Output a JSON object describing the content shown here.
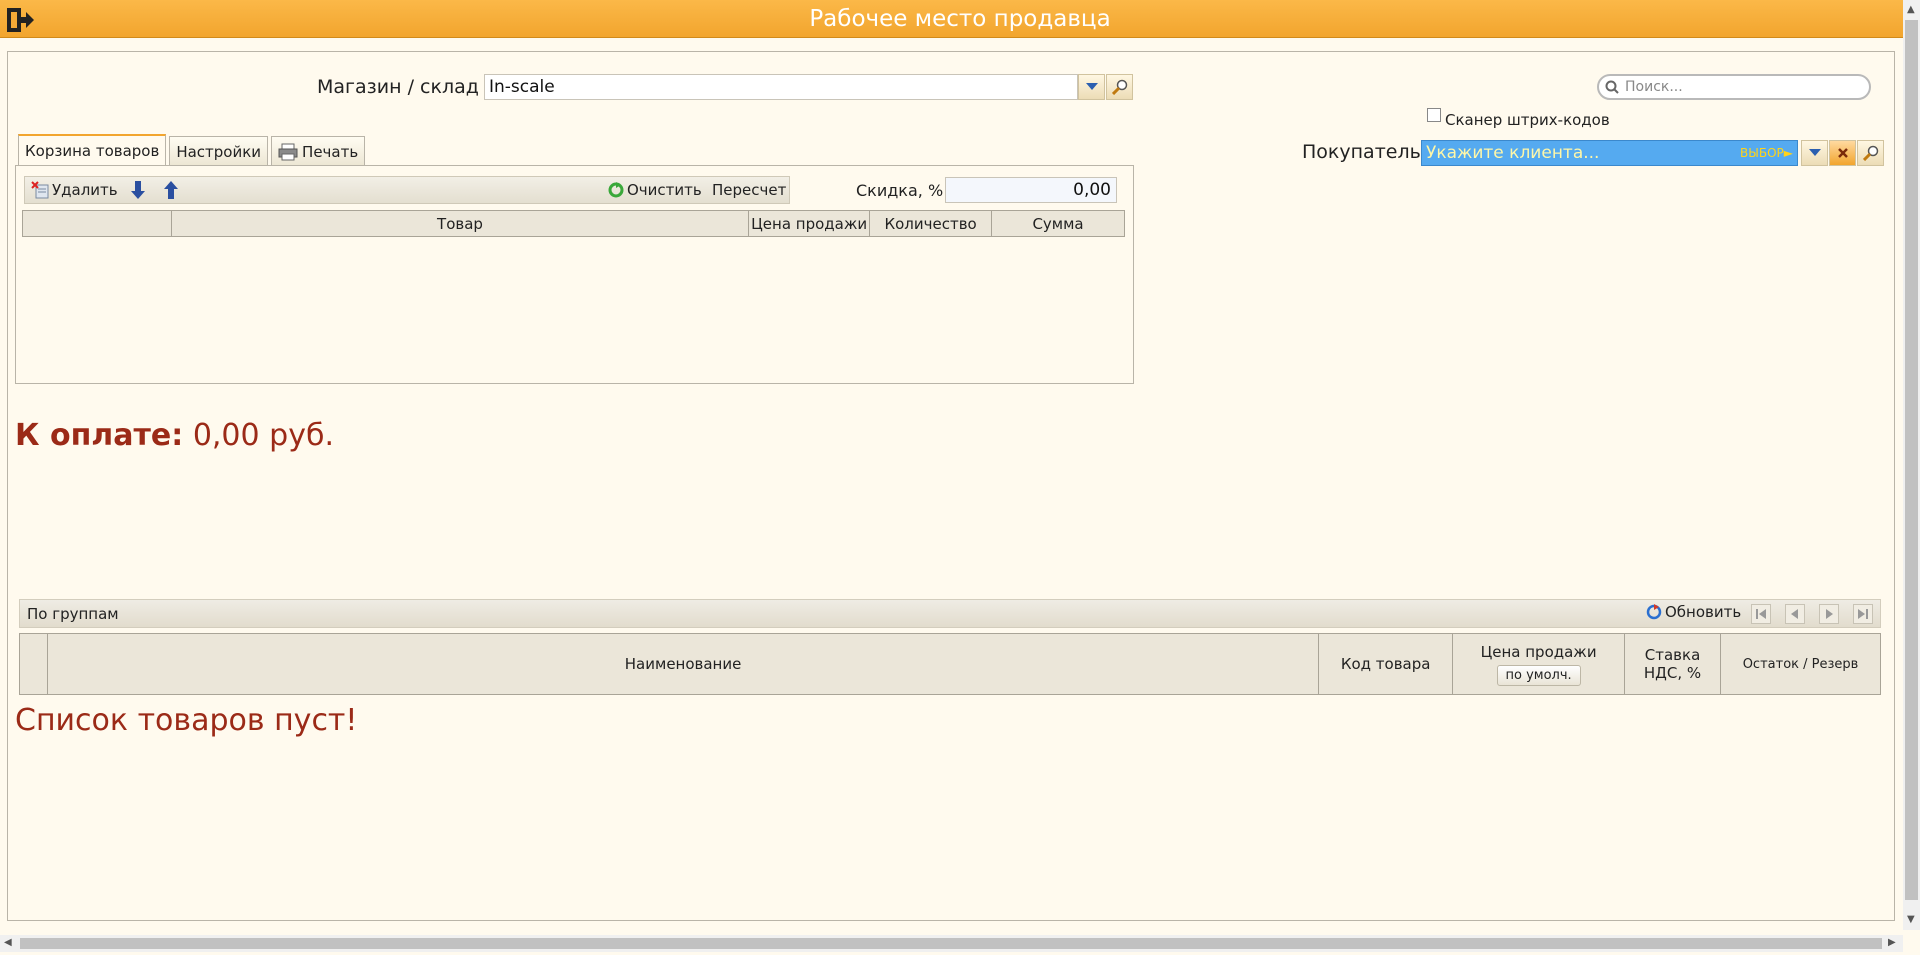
{
  "window": {
    "title": "Рабочее место продавца"
  },
  "store": {
    "label": "Магазин / склад",
    "value": "In-scale"
  },
  "search": {
    "placeholder": "Поиск..."
  },
  "scanner": {
    "label": "Сканер штрих-кодов",
    "checked": false
  },
  "buyer": {
    "label": "Покупатель",
    "placeholder": "Укажите клиента...",
    "choose_hint": "ВЫБОР►"
  },
  "tabs": [
    {
      "label": "Корзина товаров",
      "active": true
    },
    {
      "label": "Настройки",
      "active": false
    },
    {
      "label": "Печать",
      "active": false
    }
  ],
  "cart_toolbar": {
    "delete": "Удалить",
    "clear": "Очистить",
    "recalc": "Пересчет"
  },
  "discount": {
    "label": "Скидка, %",
    "value": "0,00"
  },
  "cart_table": {
    "columns": [
      "",
      "Товар",
      "Цена продажи",
      "Количество",
      "Сумма"
    ]
  },
  "to_pay": {
    "label": "К оплате:",
    "amount": "0,00 руб."
  },
  "goods_bar": {
    "groups": "По группам",
    "refresh": "Обновить"
  },
  "goods_table": {
    "columns": {
      "name": "Наименование",
      "code": "Код товара",
      "price": "Цена продажи",
      "price_button": "по умолч.",
      "vat_line1": "Ставка",
      "vat_line2": "НДС, %",
      "stock": "Остаток / Резерв"
    }
  },
  "empty_message": "Список товаров пуст!",
  "colors": {
    "title_bar": "#f2a52e",
    "alert_text": "#9b2a17",
    "buyer_field": "#55aaf0"
  }
}
